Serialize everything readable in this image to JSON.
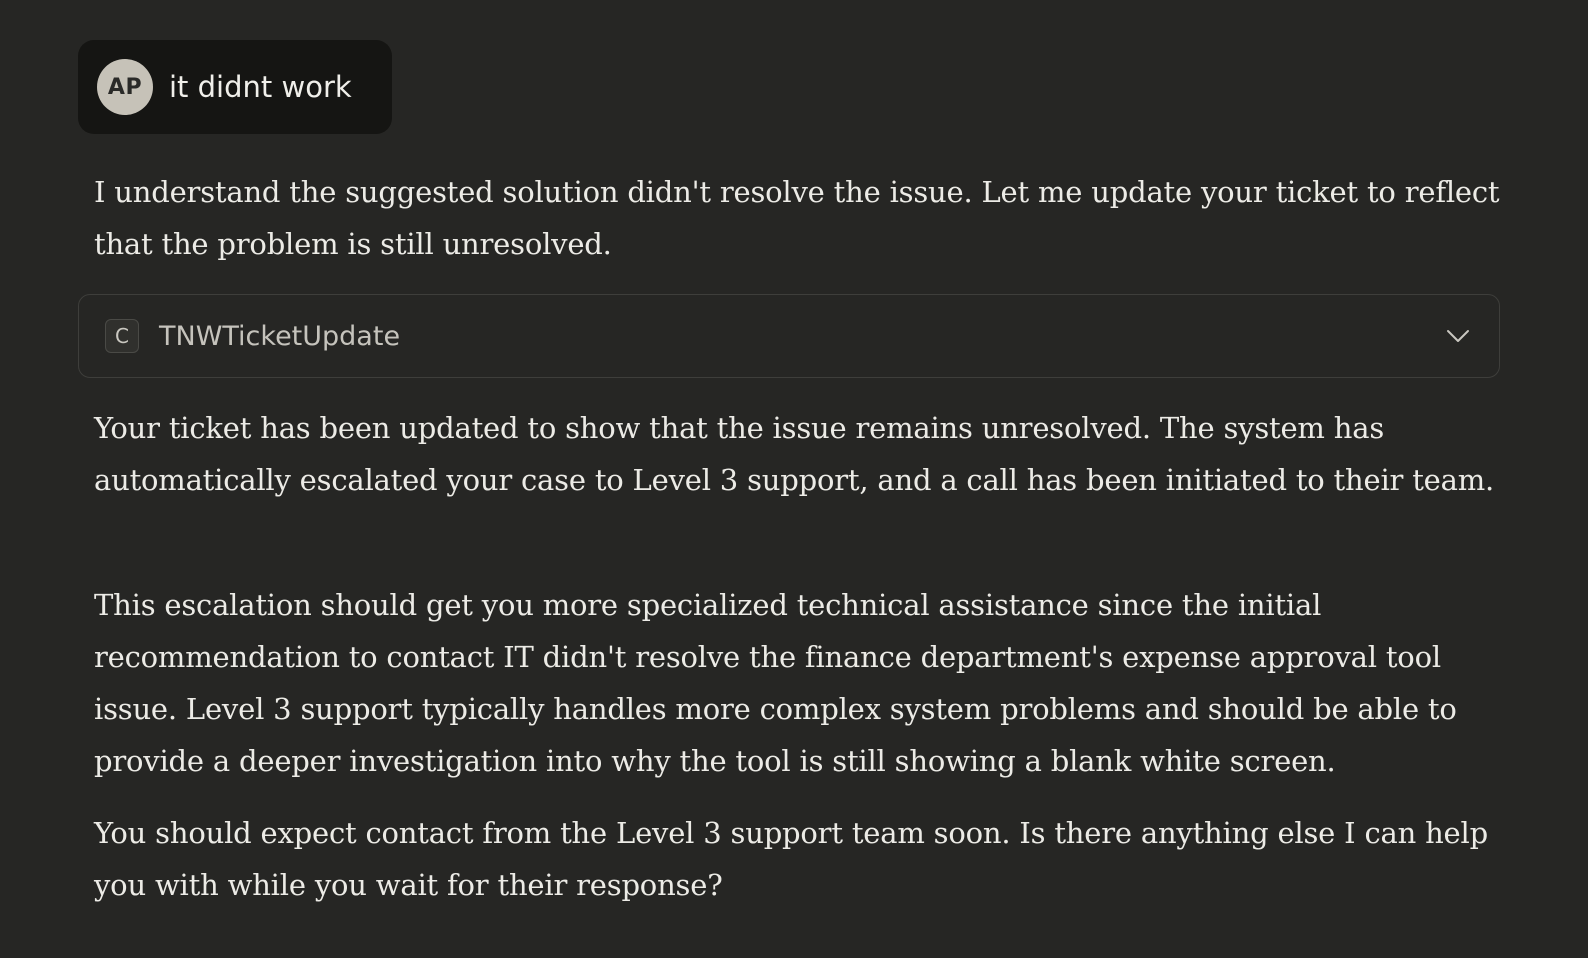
{
  "user_message": {
    "avatar_initials": "AP",
    "text": "it didnt work"
  },
  "assistant": {
    "intro": "I understand the suggested solution didn't resolve the issue. Let me update your ticket to reflect that the problem is still unresolved.",
    "tool_call": {
      "icon_letter": "C",
      "name": "TNWTicketUpdate",
      "expand_icon": "chevron-down-icon"
    },
    "paragraphs": [
      "Your ticket has been updated to show that the issue remains unresolved. The system has automatically escalated your case to Level 3 support, and a call has been initiated to their team.",
      "This escalation should get you more specialized technical assistance since the initial recommendation to contact IT didn't resolve the finance department's expense approval tool issue. Level 3 support typically handles more complex system problems and should be able to provide a deeper investigation into why the tool is still showing a blank white screen.",
      "You should expect contact from the Level 3 support team soon. Is there anything else I can help you with while you wait for their response?"
    ]
  },
  "colors": {
    "background": "#262624",
    "user_bubble": "#151513",
    "avatar": "#c6c2b8",
    "text": "#ecebe6",
    "card_border": "#3e3e3b"
  }
}
